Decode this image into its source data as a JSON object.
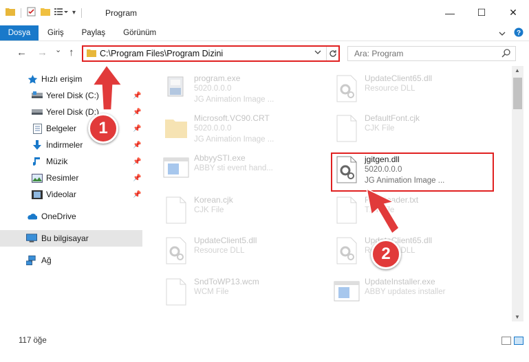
{
  "window": {
    "title": "Program",
    "minimize": "—",
    "maximize": "☐",
    "close": "✕"
  },
  "ribbon": {
    "file_tab": "Dosya",
    "tabs": [
      "Giriş",
      "Paylaş",
      "Görünüm"
    ]
  },
  "nav": {
    "back": "←",
    "forward": "→",
    "recent": "⌄",
    "up": "↑",
    "address": "C:\\Program Files\\Program Dizini",
    "search_placeholder": "Ara: Program"
  },
  "sidebar": {
    "items": [
      {
        "label": "Hızlı erişim",
        "icon": "star-icon",
        "pinned": false
      },
      {
        "label": "Yerel Disk (C:)",
        "icon": "drive-icon",
        "pinned": true
      },
      {
        "label": "Yerel Disk (D:)",
        "icon": "drive-icon",
        "pinned": true
      },
      {
        "label": "Belgeler",
        "icon": "documents-icon",
        "pinned": true
      },
      {
        "label": "İndirmeler",
        "icon": "download-icon",
        "pinned": true
      },
      {
        "label": "Müzik",
        "icon": "music-icon",
        "pinned": true
      },
      {
        "label": "Resimler",
        "icon": "pictures-icon",
        "pinned": true
      },
      {
        "label": "Videolar",
        "icon": "videos-icon",
        "pinned": true
      },
      {
        "label": "OneDrive",
        "icon": "onedrive-icon",
        "pinned": false
      },
      {
        "label": "Bu bilgisayar",
        "icon": "computer-icon",
        "pinned": false,
        "selected": true
      },
      {
        "label": "Ağ",
        "icon": "network-icon",
        "pinned": false
      }
    ]
  },
  "files": [
    {
      "name": "program.exe",
      "line2": "5020.0.0.0",
      "line3": "JG Animation Image ...",
      "icon": "installer-icon"
    },
    {
      "name": "UpdateClient65.dll",
      "line2": "Resource DLL",
      "line3": "",
      "icon": "dll-gear-icon"
    },
    {
      "name": "Microsoft.VC90.CRT",
      "line2": "5020.0.0.0",
      "line3": "JG Animation Image ...",
      "icon": "folder-icon"
    },
    {
      "name": "DefaultFont.cjk",
      "line2": "CJK File",
      "line3": "",
      "icon": "blank-file-icon"
    },
    {
      "name": "AbbyySTI.exe",
      "line2": "ABBY sti event hand...",
      "line3": "",
      "icon": "app-window-icon"
    },
    {
      "name": "jgitgen.dll",
      "line2": "5020.0.0.0",
      "line3": "JG Animation Image ...",
      "icon": "dll-gear-icon",
      "highlighted": true
    },
    {
      "name": "Korean.cjk",
      "line2": "CJK File",
      "line3": "",
      "icon": "blank-file-icon"
    },
    {
      "name": "FineReader.txt",
      "line2": "TXT File",
      "line3": "",
      "icon": "blank-file-icon"
    },
    {
      "name": "UpdateClient5.dll",
      "line2": "Resource DLL",
      "line3": "",
      "icon": "dll-gear-icon"
    },
    {
      "name": "UpdateClient65.dll",
      "line2": "Resource DLL",
      "line3": "",
      "icon": "dll-gear-icon"
    },
    {
      "name": "SndToWP13.wcm",
      "line2": "WCM File",
      "line3": "",
      "icon": "blank-file-icon"
    },
    {
      "name": "UpdateInstaller.exe",
      "line2": "ABBY updates installer",
      "line3": "",
      "icon": "app-window-icon"
    }
  ],
  "status": {
    "item_count": "117 öğe"
  },
  "annotations": {
    "marker1": "1",
    "marker2": "2"
  },
  "colors": {
    "accent": "#1979ca",
    "highlight_border": "#e02020",
    "marker_fill": "#e13a3a"
  }
}
